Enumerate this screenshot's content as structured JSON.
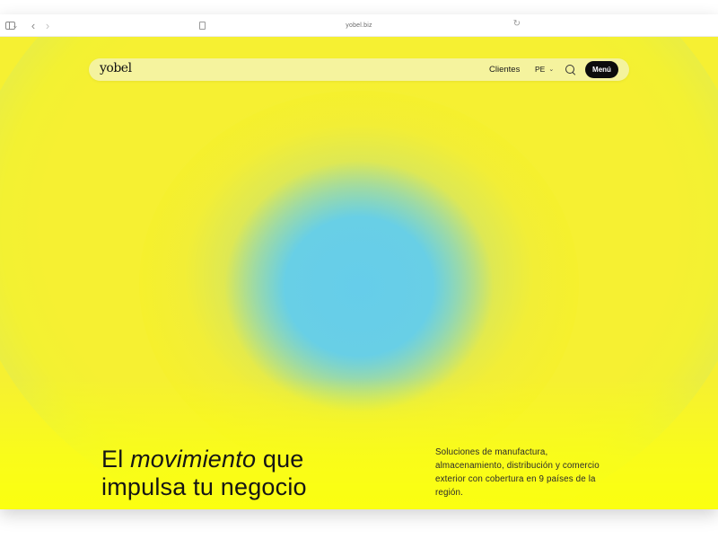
{
  "browser": {
    "url": "yobel.biz"
  },
  "nav": {
    "logo": "yobel",
    "clients_label": "Clientes",
    "language": "PE",
    "menu_label": "Menú"
  },
  "hero": {
    "headline_part1": "El ",
    "headline_italic": "movimiento",
    "headline_part2": " que",
    "headline_line2": "impulsa tu negocio",
    "description": "Soluciones de manufactura, almacenamiento, distribución y comercio exterior con cobertura en 9 países de la región."
  },
  "colors": {
    "accent_yellow": "#fbff12",
    "center_blue": "#66cdea",
    "menu_button_bg": "#0c0c0c"
  },
  "icons": [
    "sidebar-toggle-icon",
    "chevron-down-icon",
    "back-arrow-icon",
    "forward-arrow-icon",
    "page-icon",
    "reload-icon",
    "search-icon"
  ]
}
